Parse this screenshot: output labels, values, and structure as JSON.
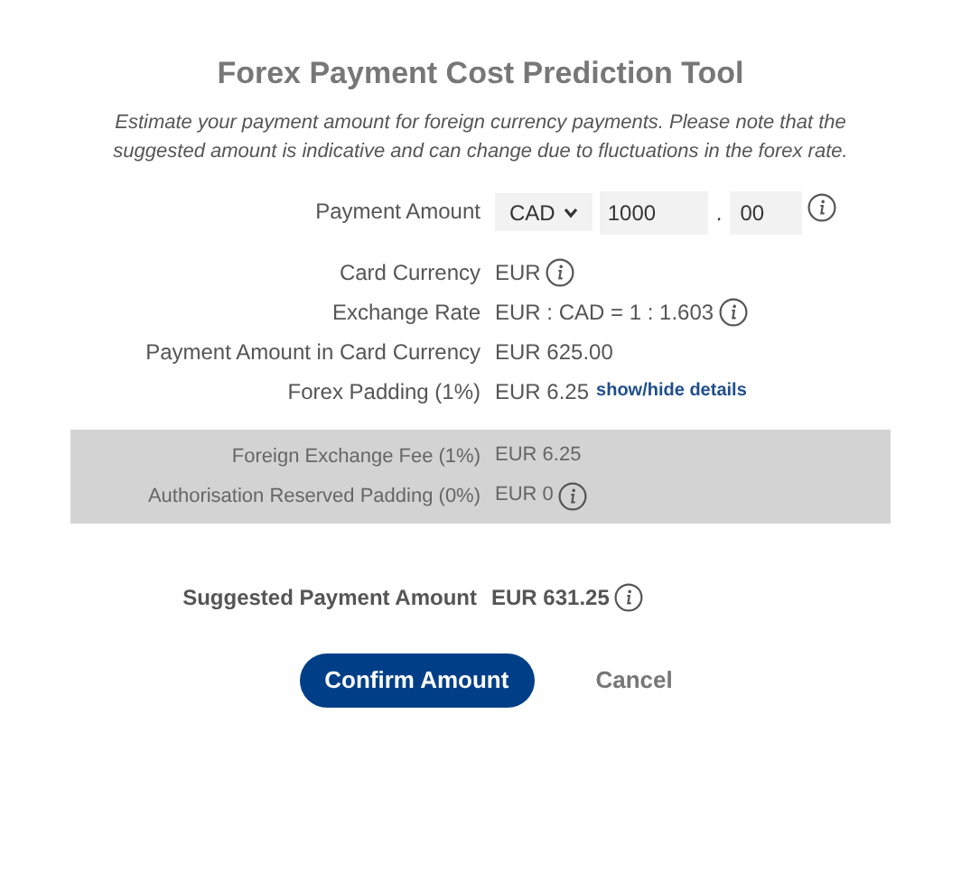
{
  "title": "Forex Payment Cost Prediction Tool",
  "description": "Estimate your payment amount for foreign currency payments. Please note that the suggested amount is indicative and can change due to fluctuations in the forex rate.",
  "payment_amount": {
    "label": "Payment Amount",
    "currency": "CAD",
    "whole": "1000",
    "separator": ".",
    "decimal": "00",
    "info": true
  },
  "rows": [
    {
      "label": "Card Currency",
      "value": "EUR",
      "info": true
    },
    {
      "label": "Exchange Rate",
      "value": "EUR : CAD = 1 : 1.603",
      "info": true
    },
    {
      "label": "Payment Amount in Card Currency",
      "value": "EUR 625.00",
      "info": false
    },
    {
      "label": "Forex Padding (1%)",
      "value": "EUR 6.25",
      "info": false,
      "link": "show/hide details"
    }
  ],
  "details": {
    "expanded": true,
    "rows": [
      {
        "label": "Foreign Exchange Fee (1%)",
        "value": "EUR 6.25",
        "info": false
      },
      {
        "label": "Authorisation Reserved Padding (0%)",
        "value": "EUR 0",
        "info": true
      }
    ]
  },
  "suggested": {
    "label": "Suggested Payment Amount",
    "value": "EUR 631.25",
    "info": true
  },
  "buttons": [
    {
      "label": "Confirm Amount",
      "kind": "primary"
    },
    {
      "label": "Cancel",
      "kind": "secondary"
    }
  ]
}
